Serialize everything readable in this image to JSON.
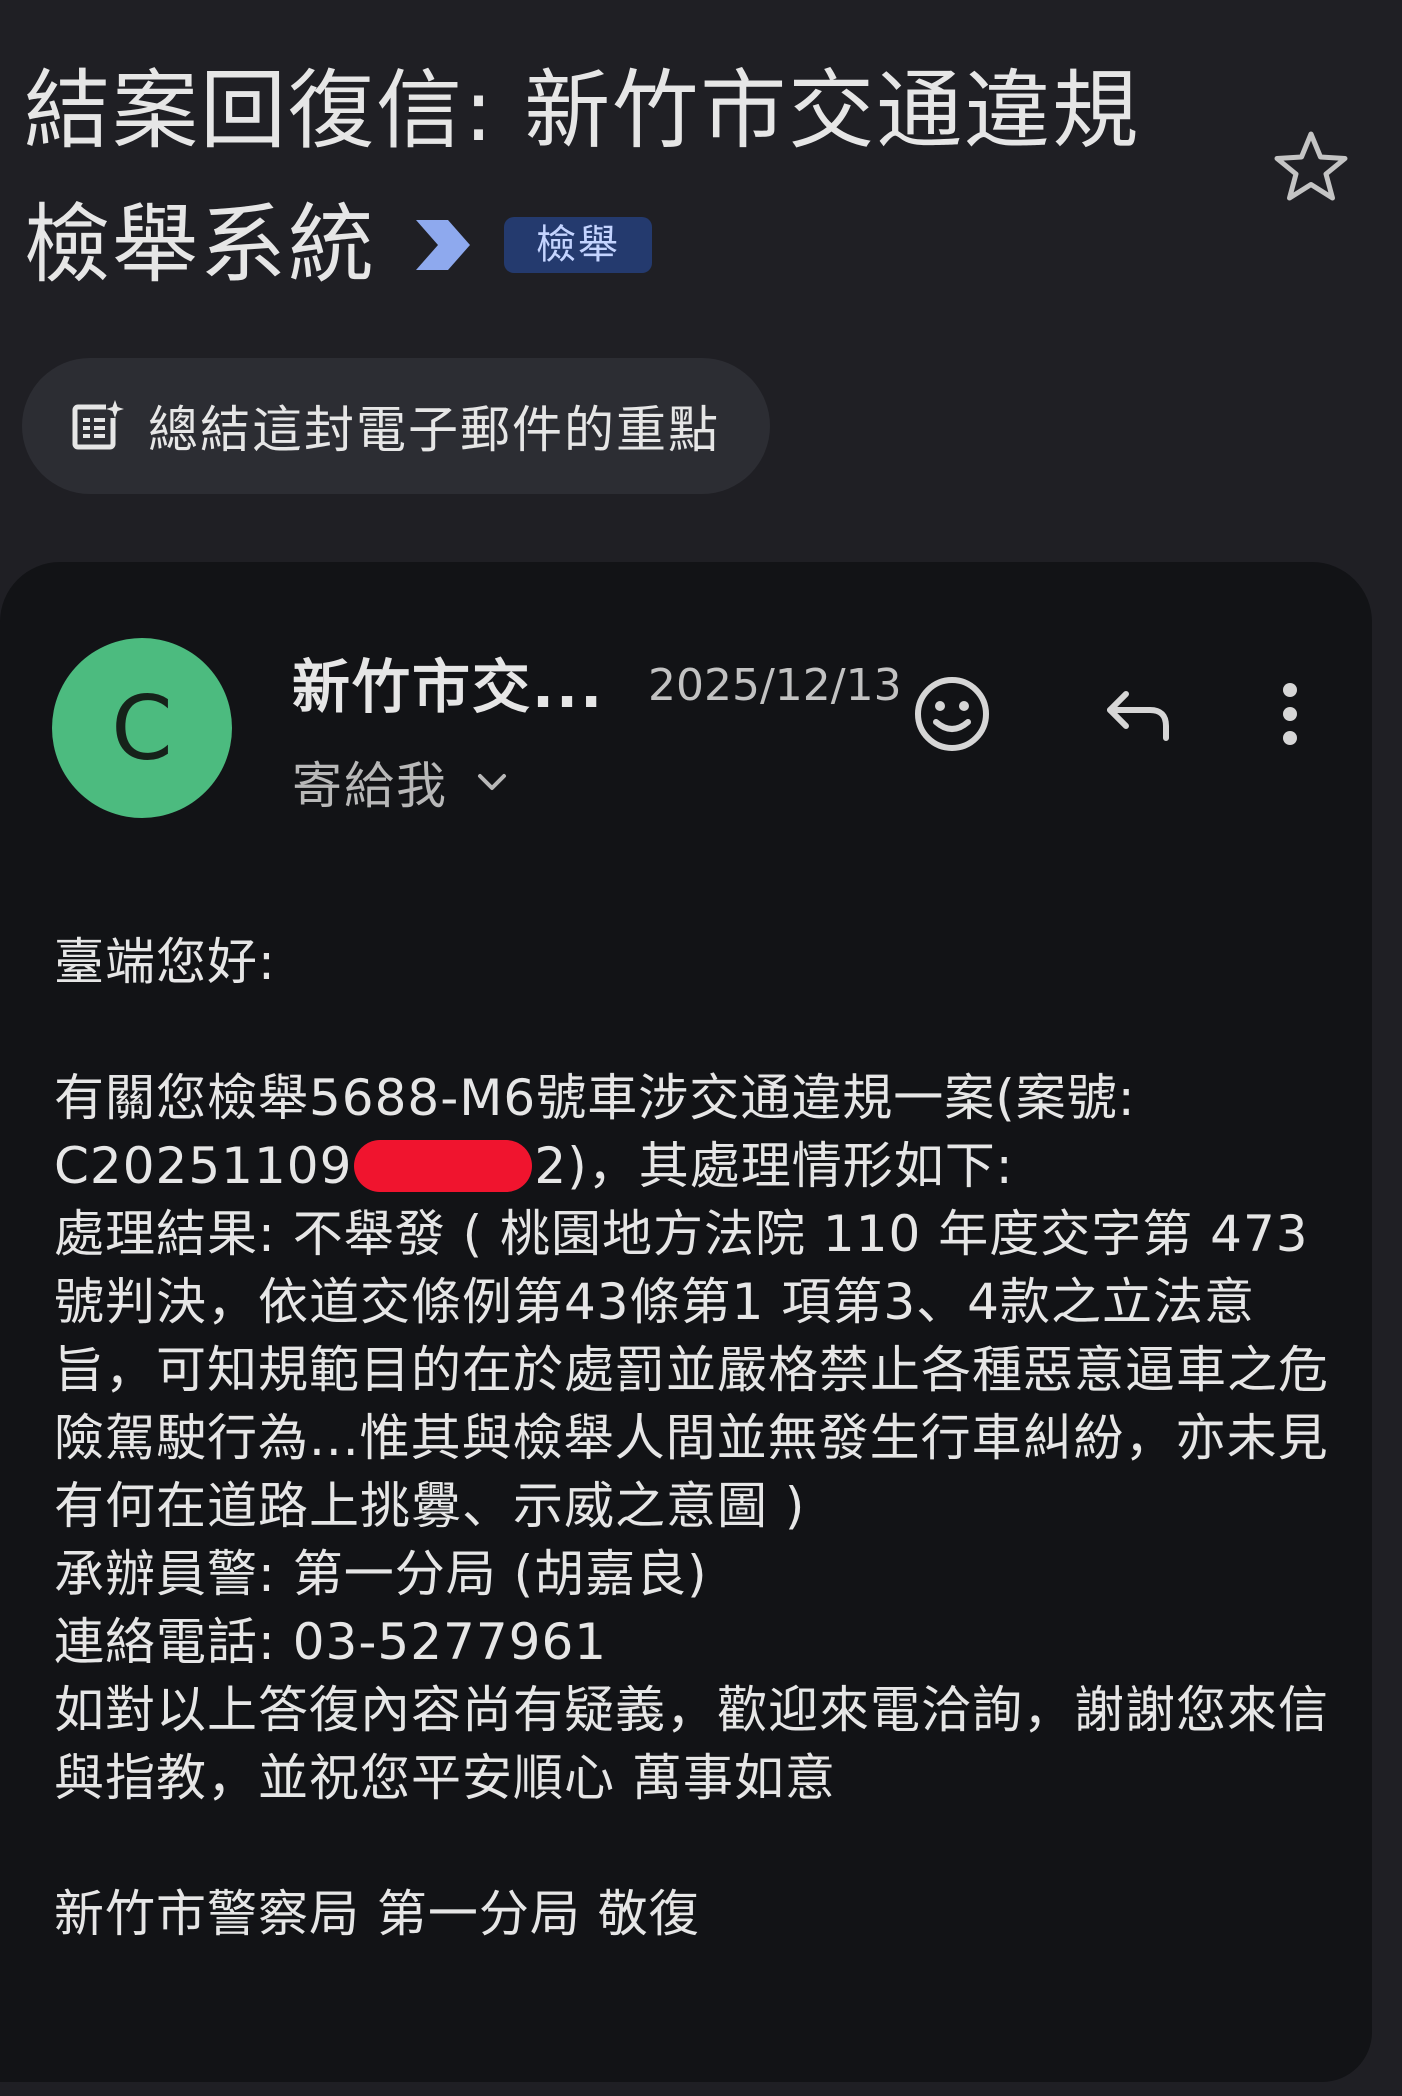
{
  "header": {
    "subject": "結案回復信: 新竹市交通違規檢舉系統",
    "label": "檢舉"
  },
  "summarize": {
    "label": "總結這封電子郵件的重點"
  },
  "message": {
    "avatar_letter": "C",
    "sender": "新竹市交...",
    "date": "2025/12/13",
    "recipient": "寄給我",
    "body": {
      "greeting": "臺端您好:",
      "line_case_a": "有關您檢舉5688-M6號車涉交通違規一案(案號:",
      "line_case_b_prefix": "C20251109",
      "line_case_b_suffix": "2)，其處理情形如下:",
      "result": "處理結果: 不舉發 ( 桃園地方法院 110 年度交字第 473 號判決，依道交條例第43條第1 項第3、4款之立法意旨，可知規範目的在於處罰並嚴格禁止各種惡意逼車之危險駕駛行為...惟其與檢舉人間並無發生行車糾紛，亦未見有何在道路上挑釁、示威之意圖 )",
      "officer": "承辦員警: 第一分局 (胡嘉良)",
      "phone": "連絡電話: 03-5277961",
      "closing": "如對以上答復內容尚有疑義，歡迎來電洽詢，謝謝您來信與指教，並祝您平安順心 萬事如意",
      "signature": "新竹市警察局 第一分局 敬復"
    }
  },
  "icons": {
    "importance": "importance-marker-icon",
    "star": "star-icon",
    "summarize": "sparkle-summary-icon",
    "emoji": "emoji-reaction-icon",
    "reply": "reply-icon",
    "more": "more-vertical-icon",
    "expand": "chevron-down-icon"
  },
  "colors": {
    "background": "#1f1f24",
    "card": "#121316",
    "avatar": "#4cbb7f",
    "label_chip": "#243a6e",
    "importance": "#8ea9ee",
    "redaction": "#f0142e"
  }
}
